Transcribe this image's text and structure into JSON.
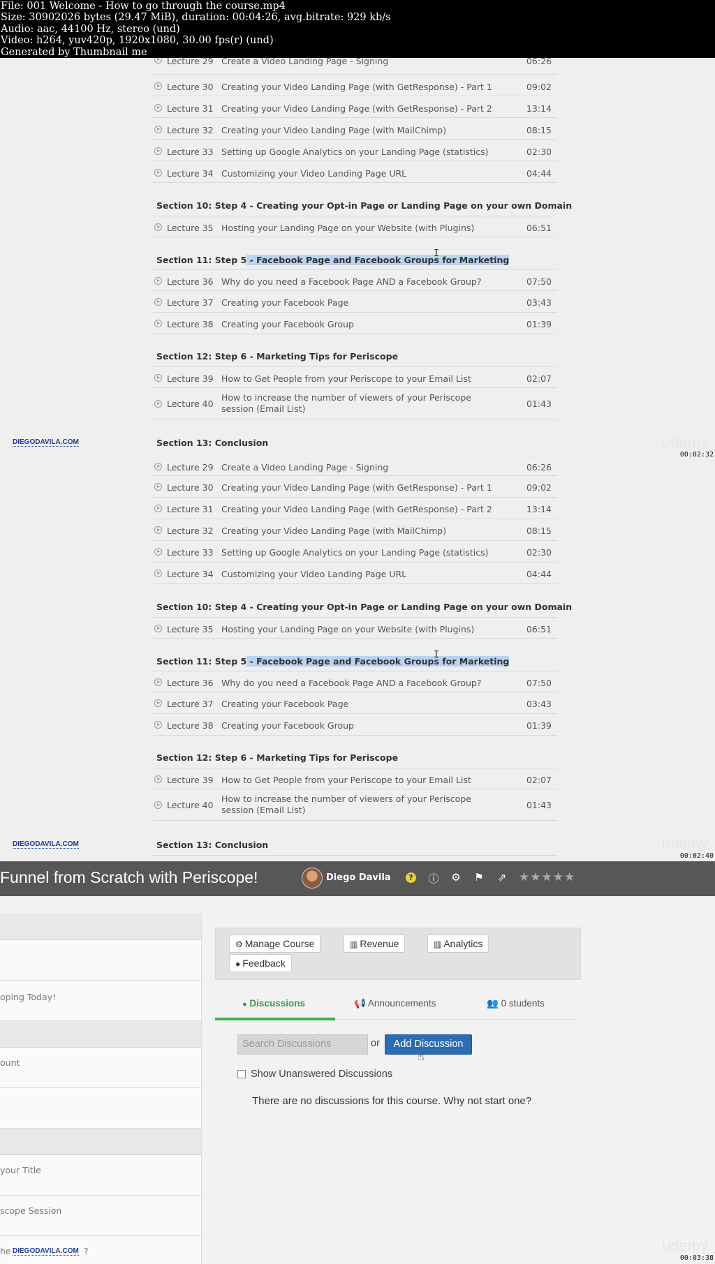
{
  "info_header": [
    "File: 001 Welcome - How to go through the course.mp4",
    "Size: 30902026 bytes (29.47 MiB), duration: 00:04:26, avg.bitrate: 929 kb/s",
    "Audio: aac, 44100 Hz, stereo (und)",
    "Video: h264, yuv420p, 1920x1080, 30.00 fps(r) (und)",
    "Generated by Thumbnail me"
  ],
  "curriculum": {
    "lectures_a": [
      {
        "num": "Lecture 29",
        "title": "Create a Video Landing Page - Signing",
        "duration": "06:26"
      },
      {
        "num": "Lecture 30",
        "title": "Creating your Video Landing Page (with GetResponse) - Part 1",
        "duration": "09:02"
      },
      {
        "num": "Lecture 31",
        "title": "Creating your Video Landing Page (with GetResponse) - Part 2",
        "duration": "13:14"
      },
      {
        "num": "Lecture 32",
        "title": "Creating your Video Landing Page (with MailChimp)",
        "duration": "08:15"
      },
      {
        "num": "Lecture 33",
        "title": "Setting up Google Analytics on your Landing Page (statistics)",
        "duration": "02:30"
      },
      {
        "num": "Lecture 34",
        "title": "Customizing your Video Landing Page URL",
        "duration": "04:44"
      }
    ],
    "section_10": "Section 10: Step 4 - Creating your Opt-in Page or Landing Page on your own Domain",
    "lecture_35": {
      "num": "Lecture 35",
      "title": "Hosting your Landing Page on your Website (with Plugins)",
      "duration": "06:51"
    },
    "section_11_prefix": "Section 11: Step 5",
    "section_11_highlight": " - Facebook Page and Facebook Groups for Marketing",
    "lectures_b": [
      {
        "num": "Lecture 36",
        "title": "Why do you need a Facebook Page AND a Facebook Group?",
        "duration": "07:50"
      },
      {
        "num": "Lecture 37",
        "title": "Creating your Facebook Page",
        "duration": "03:43"
      },
      {
        "num": "Lecture 38",
        "title": "Creating your Facebook Group",
        "duration": "01:39"
      }
    ],
    "section_12": "Section 12: Step 6 - Marketing Tips for Periscope",
    "lectures_c": [
      {
        "num": "Lecture 39",
        "title": "How to Get People from your Periscope to your Email List",
        "duration": "02:07"
      },
      {
        "num": "Lecture 40",
        "title": "How to increase the number of viewers of your Periscope session (Email List)",
        "duration": "01:43"
      }
    ],
    "section_13": "Section 13: Conclusion"
  },
  "logo_text": "DIEGODAVILA.COM",
  "watermark": "udemy",
  "timestamps": [
    "00:02:32",
    "00:02:40",
    "00:03:38"
  ],
  "frame3": {
    "course_title": "Funnel from Scratch with Periscope!",
    "author": "Diego Davila",
    "left_items": [
      "oping Today!",
      "ount",
      "your Title",
      "scope Session",
      "he",
      "?"
    ],
    "buttons": {
      "manage": "Manage Course",
      "revenue": "Revenue",
      "analytics": "Analytics",
      "feedback": "Feedback"
    },
    "tabs": {
      "discussions": "Discussions",
      "announcements": "Announcements",
      "students": "0 students"
    },
    "search_placeholder": "Search Discussions",
    "or_text": "or",
    "add_discussion": "Add Discussion",
    "show_unanswered": "Show Unanswered Discussions",
    "empty_message": "There are no discussions for this course. Why not start one?"
  },
  "icons": [
    "play-circle-icon",
    "text-cursor-icon",
    "help-icon",
    "info-icon",
    "gear-icon",
    "flag-icon",
    "share-icon",
    "star-icon",
    "gear-small-icon",
    "bar-chart-icon",
    "comments-icon",
    "bullhorn-icon",
    "users-icon",
    "hand-pointer-icon"
  ]
}
